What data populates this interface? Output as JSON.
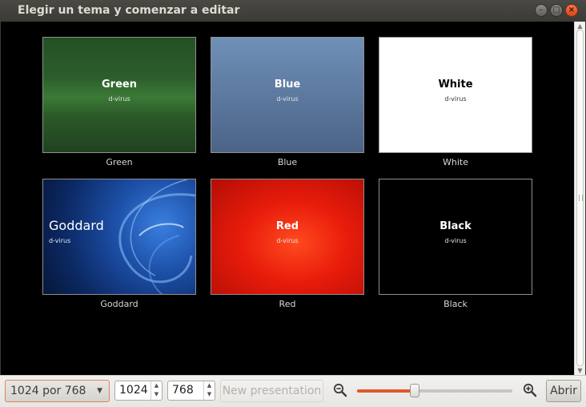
{
  "window": {
    "title": "Elegir un tema y comenzar a editar",
    "buttons": {
      "minimize": "–",
      "maximize": "□",
      "close": "×"
    }
  },
  "themes": [
    {
      "name": "Green",
      "title": "Green",
      "subtitle": "d-virus"
    },
    {
      "name": "Blue",
      "title": "Blue",
      "subtitle": "d-virus"
    },
    {
      "name": "White",
      "title": "White",
      "subtitle": "d-virus"
    },
    {
      "name": "Goddard",
      "title": "Goddard",
      "subtitle": "d-virus"
    },
    {
      "name": "Red",
      "title": "Red",
      "subtitle": "d-virus"
    },
    {
      "name": "Black",
      "title": "Black",
      "subtitle": "d-virus"
    }
  ],
  "scrollbar": {
    "up_arrow": "▲",
    "down_arrow": "▼"
  },
  "toolbar": {
    "size_select": {
      "value": "1024 por 768",
      "arrow": "▼"
    },
    "width_input": {
      "value": "1024"
    },
    "height_input": {
      "value": "768"
    },
    "spin_up": "▲",
    "spin_down": "▼",
    "new_presentation_label": "New presentation",
    "zoom_level": 0.37,
    "open_label": "Abrir"
  },
  "colors": {
    "accent": "#e0582b",
    "title_bar": "#3c3b37",
    "content_background": "#000000"
  }
}
